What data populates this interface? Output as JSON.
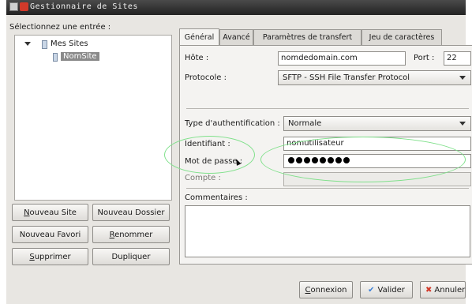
{
  "window": {
    "title": "Gestionnaire de Sites"
  },
  "left": {
    "select_label": "Sélectionnez une entrée :",
    "tree": [
      {
        "label": "Mes Sites"
      },
      {
        "label": "NomSite"
      }
    ],
    "buttons": {
      "new_site": "Nouveau Site",
      "new_folder": "Nouveau Dossier",
      "new_bookmark": "Nouveau Favori",
      "rename": "Renommer",
      "delete": "Supprimer",
      "duplicate": "Dupliquer"
    }
  },
  "tabs": [
    {
      "label": "Général"
    },
    {
      "label": "Avancé"
    },
    {
      "label": "Paramètres de transfert"
    },
    {
      "label": "Jeu de caractères"
    }
  ],
  "general": {
    "host_label": "Hôte :",
    "host_value": "nomdedomain.com",
    "port_label": "Port :",
    "port_value": "22",
    "protocol_label": "Protocole :",
    "protocol_value": "SFTP - SSH File Transfer Protocol",
    "auth_label": "Type d'authentification :",
    "auth_value": "Normale",
    "user_label": "Identifiant :",
    "user_value": "nomutilisateur",
    "password_label": "Mot de passe :",
    "password_dots": 8,
    "account_label": "Compte :",
    "comments_label": "Commentaires :"
  },
  "footer": {
    "connect": "Connexion",
    "validate": "Valider",
    "cancel": "Annuler"
  },
  "colors": {
    "highlight_ring": "#7fe08a",
    "selection": "#8a8a8a"
  }
}
